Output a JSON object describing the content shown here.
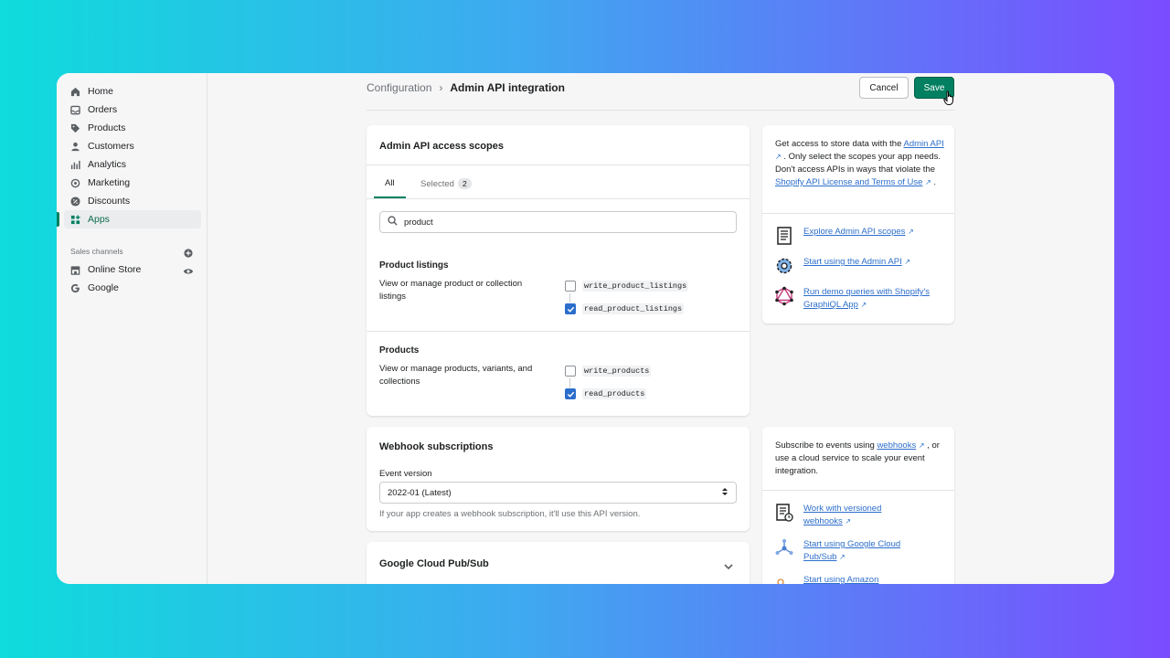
{
  "sidebar": {
    "items": [
      {
        "label": "Home",
        "icon": "home-icon"
      },
      {
        "label": "Orders",
        "icon": "orders-icon"
      },
      {
        "label": "Products",
        "icon": "tag-icon"
      },
      {
        "label": "Customers",
        "icon": "person-icon"
      },
      {
        "label": "Analytics",
        "icon": "bar-chart-icon"
      },
      {
        "label": "Marketing",
        "icon": "target-icon"
      },
      {
        "label": "Discounts",
        "icon": "discount-icon"
      },
      {
        "label": "Apps",
        "icon": "apps-icon",
        "active": true
      }
    ],
    "sales_channels_label": "Sales channels",
    "channels": [
      {
        "label": "Online Store",
        "icon": "store-icon"
      },
      {
        "label": "Google",
        "icon": "google-icon"
      }
    ]
  },
  "header": {
    "breadcrumb_parent": "Configuration",
    "breadcrumb_current": "Admin API integration",
    "cancel_label": "Cancel",
    "save_label": "Save"
  },
  "scopes_card": {
    "title": "Admin API access scopes",
    "tab_all": "All",
    "tab_selected": "Selected",
    "selected_count": "2",
    "search_value": "product",
    "groups": [
      {
        "title": "Product listings",
        "description": "View or manage product or collection listings",
        "scopes": [
          {
            "name": "write_product_listings",
            "checked": false
          },
          {
            "name": "read_product_listings",
            "checked": true
          }
        ]
      },
      {
        "title": "Products",
        "description": "View or manage products, variants, and collections",
        "scopes": [
          {
            "name": "write_products",
            "checked": false
          },
          {
            "name": "read_products",
            "checked": true
          }
        ]
      }
    ]
  },
  "side_card_1": {
    "text_1": "Get access to store data with the",
    "link_1": "Admin API",
    "text_2": ". Only select the scopes your app needs. Don't access APIs in ways that violate the",
    "link_2": "Shopify API License and Terms of Use",
    "text_3": ".",
    "resources": [
      "Explore Admin API scopes",
      "Start using the Admin API",
      "Run demo queries with Shopify's GraphiQL App"
    ]
  },
  "webhook_card": {
    "title": "Webhook subscriptions",
    "event_version_label": "Event version",
    "event_version_value": "2022-01 (Latest)",
    "help_text": "If your app creates a webhook subscription, it'll use this API version."
  },
  "side_card_2": {
    "text_1": "Subscribe to events using",
    "link_1": "webhooks",
    "text_2": ", or use a cloud service to scale your event integration.",
    "resources": [
      "Work with versioned webhooks",
      "Start using Google Cloud Pub/Sub",
      "Start using Amazon"
    ]
  },
  "pubsub_card": {
    "title": "Google Cloud Pub/Sub"
  },
  "colors": {
    "accent": "#008060",
    "link": "#2c6ecb"
  }
}
